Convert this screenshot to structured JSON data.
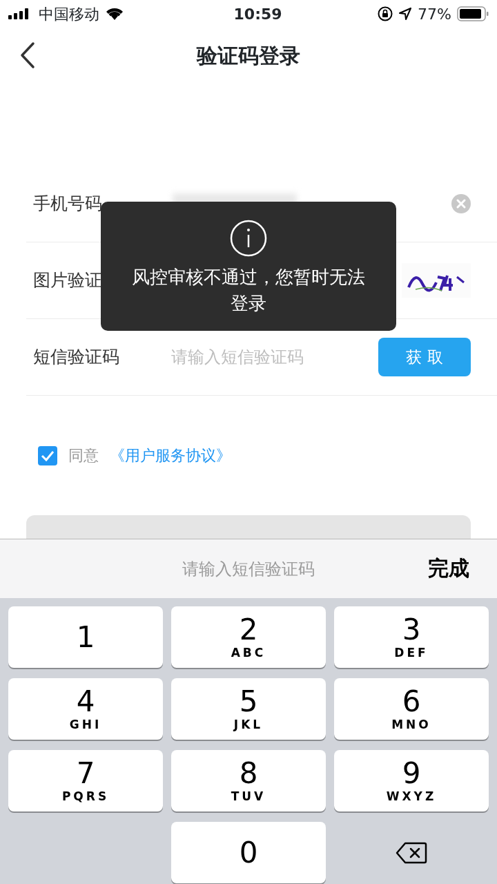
{
  "status_bar": {
    "carrier": "中国移动",
    "time": "10:59",
    "battery": "77%"
  },
  "nav": {
    "title": "验证码登录"
  },
  "fields": [
    {
      "kind": "phone",
      "label": "手机号码"
    },
    {
      "kind": "captcha",
      "label": "图片验证"
    },
    {
      "kind": "sms",
      "label": "短信验证码",
      "placeholder": "请输入短信验证码",
      "button": "获 取"
    }
  ],
  "agreement": {
    "checked": true,
    "prefix": "同意",
    "link": "《用户服务协议》"
  },
  "toast": {
    "message": "风控审核不通过，您暂时无法登录"
  },
  "keyboard_toolbar": {
    "hint": "请输入短信验证码",
    "done": "完成"
  },
  "keys": [
    {
      "kind": "digit",
      "digit": "1"
    },
    {
      "kind": "digit",
      "digit": "2",
      "letters": "ABC"
    },
    {
      "kind": "digit",
      "digit": "3",
      "letters": "DEF"
    },
    {
      "kind": "digit",
      "digit": "4",
      "letters": "GHI"
    },
    {
      "kind": "digit",
      "digit": "5",
      "letters": "JKL"
    },
    {
      "kind": "digit",
      "digit": "6",
      "letters": "MNO"
    },
    {
      "kind": "digit",
      "digit": "7",
      "letters": "PQRS"
    },
    {
      "kind": "digit",
      "digit": "8",
      "letters": "TUV"
    },
    {
      "kind": "digit",
      "digit": "9",
      "letters": "WXYZ"
    },
    {
      "kind": "blank"
    },
    {
      "kind": "digit",
      "digit": "0"
    },
    {
      "kind": "delete"
    }
  ]
}
